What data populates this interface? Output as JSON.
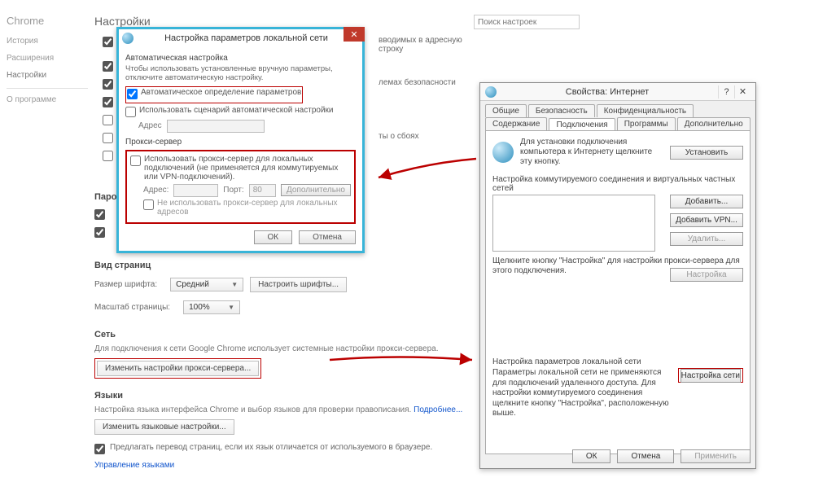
{
  "chrome": {
    "brand": "Chrome",
    "nav": [
      "История",
      "Расширения",
      "Настройки",
      "О программе"
    ],
    "title": "Настройки",
    "search_placeholder": "Поиск настроек",
    "stub_lines": [
      "вводимых в адресную строку",
      "лемах безопасности",
      "ты о сбоях"
    ],
    "passwords": {
      "header": "Пароли и формы"
    },
    "appearance": {
      "header": "Вид страниц",
      "font_label": "Размер шрифта:",
      "font_value": "Средний",
      "font_btn": "Настроить шрифты...",
      "zoom_label": "Масштаб страницы:",
      "zoom_value": "100%"
    },
    "network": {
      "header": "Сеть",
      "desc": "Для подключения к сети Google Chrome использует системные настройки прокси-сервера.",
      "proxy_btn": "Изменить настройки прокси-сервера..."
    },
    "languages": {
      "header": "Языки",
      "desc_a": "Настройка языка интерфейса Chrome и выбор языков для проверки правописания.",
      "more_link": "Подробнее...",
      "lang_btn": "Изменить языковые настройки...",
      "translate_chk": "Предлагать перевод страниц, если их язык отличается от используемого в браузере.",
      "manage_link": "Управление языками"
    }
  },
  "lan": {
    "title": "Настройка параметров локальной сети",
    "auto_header": "Автоматическая настройка",
    "auto_help": "Чтобы использовать установленные вручную параметры, отключите автоматическую настройку.",
    "auto_detect": "Автоматическое определение параметров",
    "use_script": "Использовать сценарий автоматической настройки",
    "address_label": "Адрес",
    "proxy_header": "Прокси-сервер",
    "use_proxy": "Использовать прокси-сервер для локальных подключений (не применяется для коммутируемых или VPN-подключений).",
    "addr": "Адрес:",
    "port": "Порт:",
    "port_val": "80",
    "extra": "Дополнительно",
    "bypass_local": "Не использовать прокси-сервер для локальных адресов",
    "ok": "ОК",
    "cancel": "Отмена"
  },
  "inet": {
    "title": "Свойства: Интернет",
    "tabs_row1": [
      "Общие",
      "Безопасность",
      "Конфиденциальность"
    ],
    "tabs_row2": [
      "Содержание",
      "Подключения",
      "Программы",
      "Дополнительно"
    ],
    "setup_text": "Для установки подключения компьютера к Интернету щелкните эту кнопку.",
    "setup_btn": "Установить",
    "dial_header": "Настройка коммутируемого соединения и виртуальных частных сетей",
    "add": "Добавить...",
    "add_vpn": "Добавить VPN...",
    "remove": "Удалить...",
    "settings": "Настройка",
    "dial_help": "Щелкните кнопку \"Настройка\" для настройки прокси-сервера для этого подключения.",
    "lan_header": "Настройка параметров локальной сети",
    "lan_help": "Параметры локальной сети не применяются для подключений удаленного доступа. Для настройки коммутируемого соединения щелкните кнопку \"Настройка\", расположенную выше.",
    "lan_btn": "Настройка сети",
    "ok": "ОК",
    "cancel": "Отмена",
    "apply": "Применить"
  }
}
